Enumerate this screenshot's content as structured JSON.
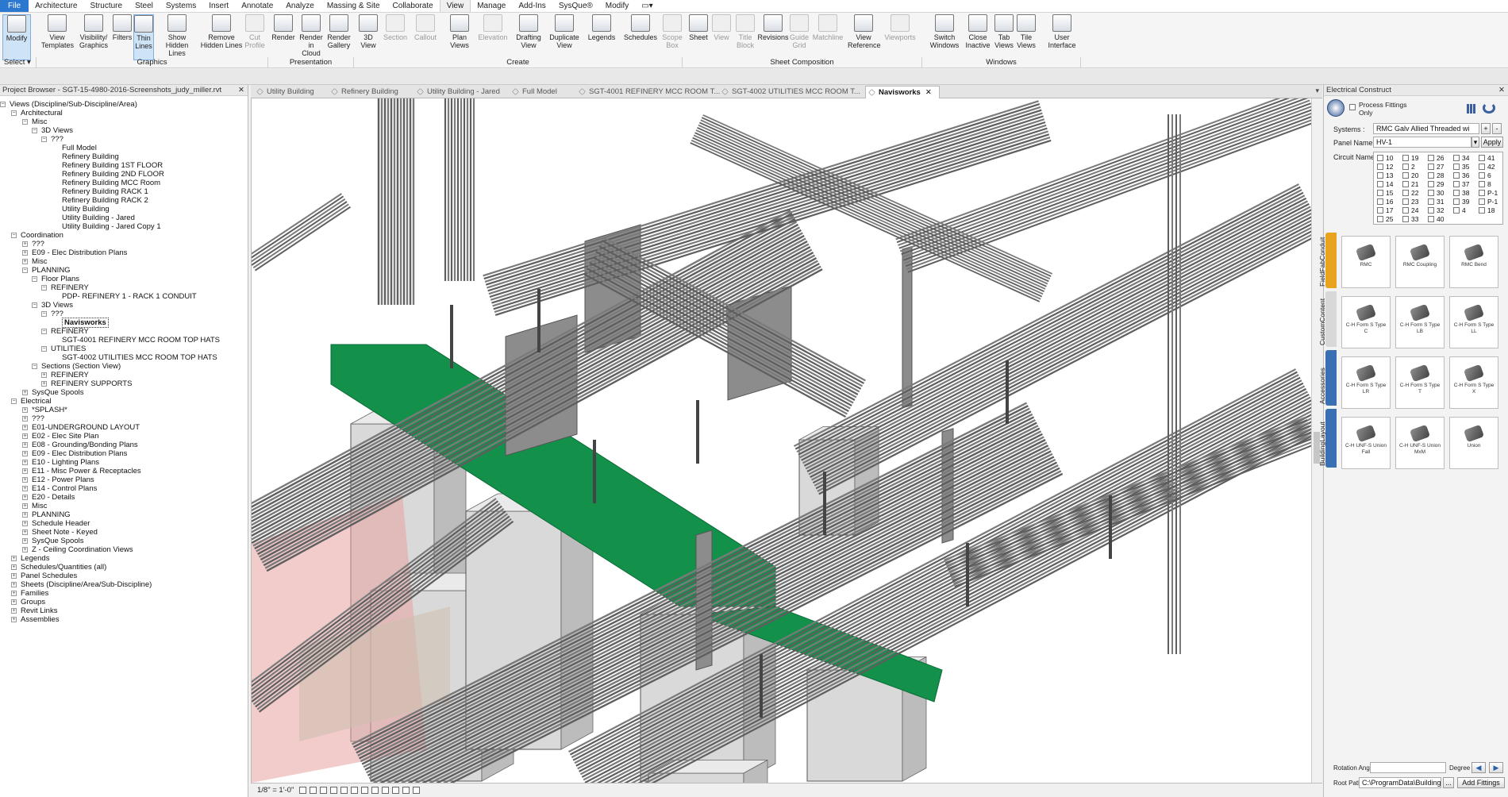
{
  "menu": {
    "items": [
      "File",
      "Architecture",
      "Structure",
      "Steel",
      "Systems",
      "Insert",
      "Annotate",
      "Analyze",
      "Massing & Site",
      "Collaborate",
      "View",
      "Manage",
      "Add-Ins",
      "SysQue®",
      "Modify"
    ],
    "active": "View"
  },
  "ribbon": {
    "select": "Select",
    "buttons": [
      {
        "label": "Modify",
        "icon": "cursor-icon"
      },
      {
        "label": "View Templates",
        "icon": "view-templates-icon"
      },
      {
        "label": "Visibility/ Graphics",
        "icon": "visibility-graphics-icon"
      },
      {
        "label": "Filters",
        "icon": "filter-icon"
      },
      {
        "label": "Thin Lines",
        "icon": "thin-lines-icon"
      },
      {
        "label": "Show Hidden Lines",
        "icon": "show-hidden-lines-icon"
      },
      {
        "label": "Remove Hidden Lines",
        "icon": "remove-hidden-lines-icon"
      },
      {
        "label": "Cut Profile",
        "icon": "cut-profile-icon"
      },
      {
        "label": "Render",
        "icon": "teapot-icon"
      },
      {
        "label": "Render in Cloud",
        "icon": "cloud-render-icon"
      },
      {
        "label": "Render Gallery",
        "icon": "render-gallery-icon"
      },
      {
        "label": "3D View",
        "icon": "house-3d-icon"
      },
      {
        "label": "Section",
        "icon": "section-icon"
      },
      {
        "label": "Callout",
        "icon": "callout-icon"
      },
      {
        "label": "Plan Views",
        "icon": "plan-views-icon"
      },
      {
        "label": "Elevation",
        "icon": "elevation-icon"
      },
      {
        "label": "Drafting View",
        "icon": "drafting-view-icon"
      },
      {
        "label": "Duplicate View",
        "icon": "duplicate-view-icon"
      },
      {
        "label": "Legends",
        "icon": "legend-icon"
      },
      {
        "label": "Schedules",
        "icon": "schedule-icon"
      },
      {
        "label": "Scope Box",
        "icon": "scope-box-icon"
      },
      {
        "label": "Sheet",
        "icon": "sheet-icon"
      },
      {
        "label": "View",
        "icon": "view-on-sheet-icon"
      },
      {
        "label": "Title Block",
        "icon": "title-block-icon"
      },
      {
        "label": "Revisions",
        "icon": "revisions-icon"
      },
      {
        "label": "Guide Grid",
        "icon": "guide-grid-icon"
      },
      {
        "label": "Matchline",
        "icon": "matchline-icon"
      },
      {
        "label": "View Reference",
        "icon": "view-reference-icon"
      },
      {
        "label": "Viewports",
        "icon": "viewports-icon"
      },
      {
        "label": "Switch Windows",
        "icon": "switch-windows-icon"
      },
      {
        "label": "Close Inactive",
        "icon": "close-inactive-icon"
      },
      {
        "label": "Tab Views",
        "icon": "tab-views-icon"
      },
      {
        "label": "Tile Views",
        "icon": "tile-views-icon"
      },
      {
        "label": "User Interface",
        "icon": "user-interface-icon"
      }
    ],
    "groups": [
      "Graphics",
      "Presentation",
      "Create",
      "Sheet Composition",
      "Windows"
    ]
  },
  "project_browser": {
    "title": "Project Browser - SGT-15-4980-2016-Screenshots_judy_miller.rvt",
    "close": "✕",
    "tree": [
      "Views (Discipline/Sub-Discipline/Area)",
      "Architectural",
      "Misc",
      "3D Views",
      "???",
      "Full Model",
      "Refinery Building",
      "Refinery Building 1ST FLOOR",
      "Refinery Building 2ND FLOOR",
      "Refinery Building MCC Room",
      "Refinery Building RACK 1",
      "Refinery Building RACK 2",
      "Utility Building",
      "Utility Building - Jared",
      "Utility Building - Jared Copy 1",
      "Coordination",
      "???",
      "E09 - Elec Distribution Plans",
      "Misc",
      "PLANNING",
      "Floor Plans",
      "REFINERY",
      "PDP- REFINERY 1 - RACK 1  CONDUIT",
      "3D Views",
      "???",
      "Navisworks",
      "REFINERY",
      "SGT-4001 REFINERY MCC ROOM TOP HATS",
      "UTILITIES",
      "SGT-4002 UTILITIES MCC ROOM TOP HATS",
      "Sections (Section View)",
      "REFINERY",
      "REFINERY SUPPORTS",
      "SysQue Spools",
      "Electrical",
      "*SPLASH*",
      "???",
      "E01-UNDERGROUND LAYOUT",
      "E02 - Elec Site Plan",
      "E08 - Grounding/Bonding Plans",
      "E09 - Elec Distribution Plans",
      "E10 - Lighting Plans",
      "E11 - Misc Power & Receptacles",
      "E12 - Power Plans",
      "E14 - Control Plans",
      "E20 - Details",
      "Misc",
      "PLANNING",
      "Schedule Header",
      "Sheet Note - Keyed",
      "SysQue Spools",
      "Z - Ceiling Coordination Views",
      "Legends",
      "Schedules/Quantities (all)",
      "Panel Schedules",
      "Sheets (Discipline/Area/Sub-Discipline)",
      "Families",
      "Groups",
      "Revit Links",
      "Assemblies"
    ]
  },
  "tabs": [
    {
      "label": "Utility Building"
    },
    {
      "label": "Refinery Building"
    },
    {
      "label": "Utility Building - Jared"
    },
    {
      "label": "Full Model"
    },
    {
      "label": "SGT-4001 REFINERY MCC ROOM T..."
    },
    {
      "label": "SGT-4002 UTILITIES MCC ROOM T..."
    },
    {
      "label": "Navisworks"
    }
  ],
  "status": {
    "scale": "1/8\" = 1'-0\""
  },
  "electrical_construct": {
    "title": "Electrical Construct",
    "process_fittings": "Process Fittings Only",
    "systems_label": "Systems :",
    "systems_value": "RMC Galv Allied Threaded wi",
    "panel_label": "Panel Name :",
    "panel_value": "HV-1",
    "apply": "Apply",
    "circuit_label": "Circuit Names :",
    "circuits": [
      "10",
      "19",
      "26",
      "34",
      "41",
      "12",
      "2",
      "27",
      "35",
      "42",
      "13",
      "20",
      "28",
      "36",
      "6",
      "14",
      "21",
      "29",
      "37",
      "8",
      "15",
      "22",
      "30",
      "38",
      "P-1",
      "16",
      "23",
      "31",
      "39",
      "P-1",
      "17",
      "24",
      "32",
      "4",
      "18",
      "25",
      "33",
      "40"
    ],
    "side_tabs": [
      "FieldFabConduit",
      "CustomContent",
      "Accessories",
      "BuildingLayout"
    ],
    "fittings": [
      "RMC",
      "RMC Coupling",
      "RMC Bend",
      "C-H Form S Type C",
      "C-H Form S Type LB",
      "C-H Form S Type LL",
      "C-H Form S Type LR",
      "C-H Form S Type T",
      "C-H Form S Type X",
      "C-H UNF-S Union Fall",
      "C-H UNF-S Union MxM",
      "Union"
    ],
    "rotation_label": "Rotation Angle :",
    "rotation_unit": "Degree",
    "root_label": "Root Path :",
    "root_value": "C:\\ProgramData\\BuildingD",
    "browse": "...",
    "add_fittings": "Add Fittings"
  },
  "colors": {
    "accent": "#2b78d1",
    "conduit": "#6f6f6f",
    "tray": "#13904a",
    "equipment": "#d9d9d9",
    "highlight": "#e8a0a0"
  }
}
